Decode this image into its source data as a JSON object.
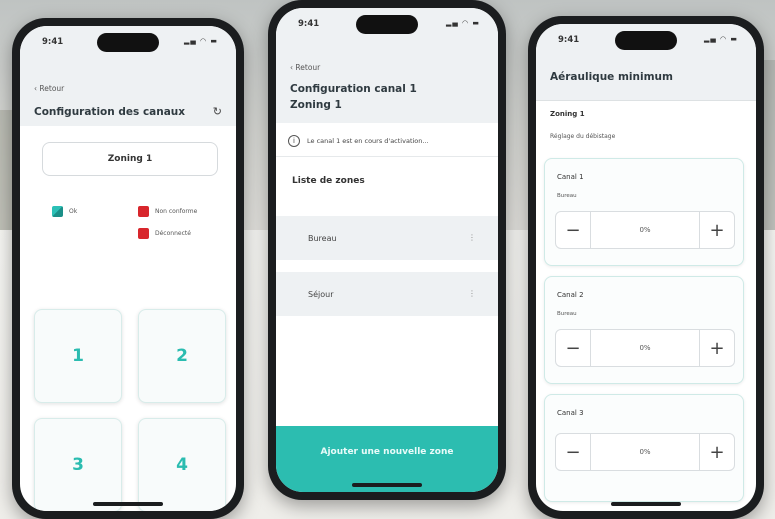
{
  "status": {
    "time": "9:41",
    "icons": "▂▄ ◠ ▬"
  },
  "phone1": {
    "back": "‹ Retour",
    "title": "Configuration des canaux",
    "zoning_button": "Zoning 1",
    "legend": {
      "ok": "Ok",
      "non_conforme": "Non conforme",
      "deconnecte": "Déconnecté"
    },
    "tiles": [
      "1",
      "2",
      "3",
      "4"
    ]
  },
  "phone2": {
    "back": "‹ Retour",
    "title_line1": "Configuration canal 1",
    "title_line2": "Zoning 1",
    "info": "Le canal 1 est en cours d'activation...",
    "zones_title": "Liste de zones",
    "zones": [
      "Bureau",
      "Séjour"
    ],
    "add_button": "Ajouter une nouvelle zone"
  },
  "phone3": {
    "title": "Aéraulique minimum",
    "zone": "Zoning 1",
    "subtitle": "Réglage du débistage",
    "canals": [
      {
        "name": "Canal 1",
        "room": "Bureau",
        "value": "0%"
      },
      {
        "name": "Canal 2",
        "room": "Bureau",
        "value": "0%"
      },
      {
        "name": "Canal 3",
        "room": "",
        "value": "0%"
      }
    ]
  },
  "colors": {
    "accent": "#2cbdb0",
    "error": "#d8262c",
    "header_bg": "#eef1f3"
  }
}
